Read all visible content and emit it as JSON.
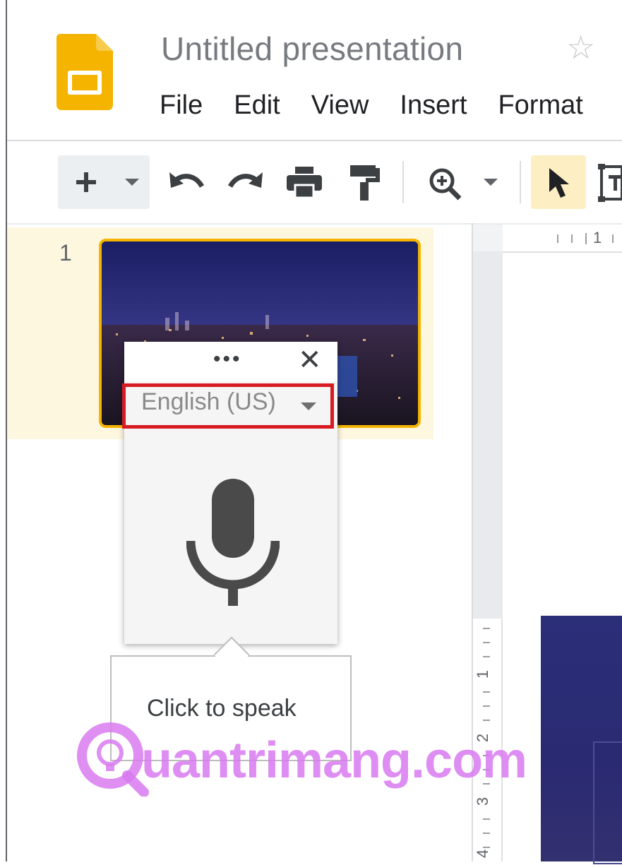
{
  "app": {
    "title": "Untitled presentation",
    "star_glyph": "☆",
    "menu": [
      "File",
      "Edit",
      "View",
      "Insert",
      "Format"
    ]
  },
  "toolbar": {
    "icons": [
      "add-icon",
      "dropdown-caret-icon",
      "undo-icon",
      "redo-icon",
      "print-icon",
      "paint-format-icon",
      "zoom-icon",
      "dropdown-caret-icon",
      "select-cursor-icon",
      "text-box-icon"
    ]
  },
  "filmstrip": {
    "slide_number": "1"
  },
  "ruler": {
    "top_label": "1",
    "left_labels": [
      "1",
      "2",
      "3",
      "4"
    ]
  },
  "voice_typing": {
    "more_glyph": "•••",
    "close_glyph": "✕",
    "language": "English (US)",
    "tooltip": "Click to speak"
  },
  "watermark": {
    "text": "uantrimang.com"
  },
  "colors": {
    "highlight": "#d81b23",
    "slides_logo": "#f4b400",
    "selection": "#fef7e0"
  }
}
